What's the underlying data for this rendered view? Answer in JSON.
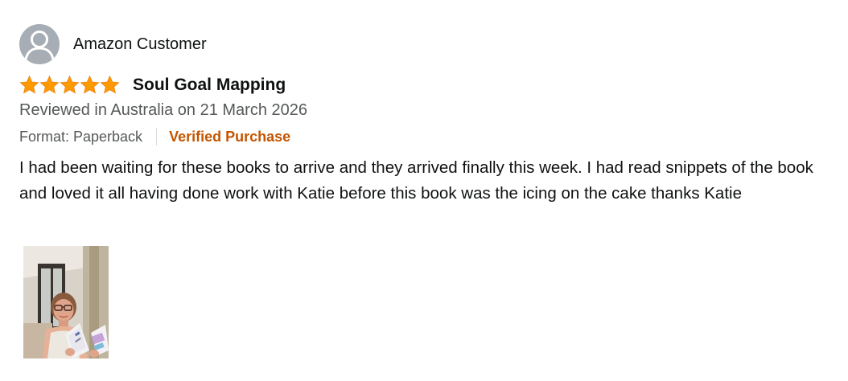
{
  "review": {
    "profile": {
      "name": "Amazon Customer",
      "avatar_icon": "default-person-avatar-icon"
    },
    "rating": {
      "stars": 5,
      "max": 5,
      "star_color": "#ff9900",
      "star_icon": "star-icon"
    },
    "title": "Soul Goal Mapping",
    "date": "Reviewed in Australia on 21 March 2026",
    "format": "Format: Paperback",
    "verified": "Verified Purchase",
    "body": "I had been waiting for these books to arrive and they arrived finally this week. I had read snippets of the book and loved it all having done work with Katie before this book was the icing on the cake thanks Katie",
    "image_count": 1
  },
  "colors": {
    "text": "#0f1111",
    "secondary_text": "#565959",
    "verified": "#c45500",
    "star": "#ff9900",
    "avatar_bg": "#a6adb4",
    "divider": "#d5d9d9"
  }
}
